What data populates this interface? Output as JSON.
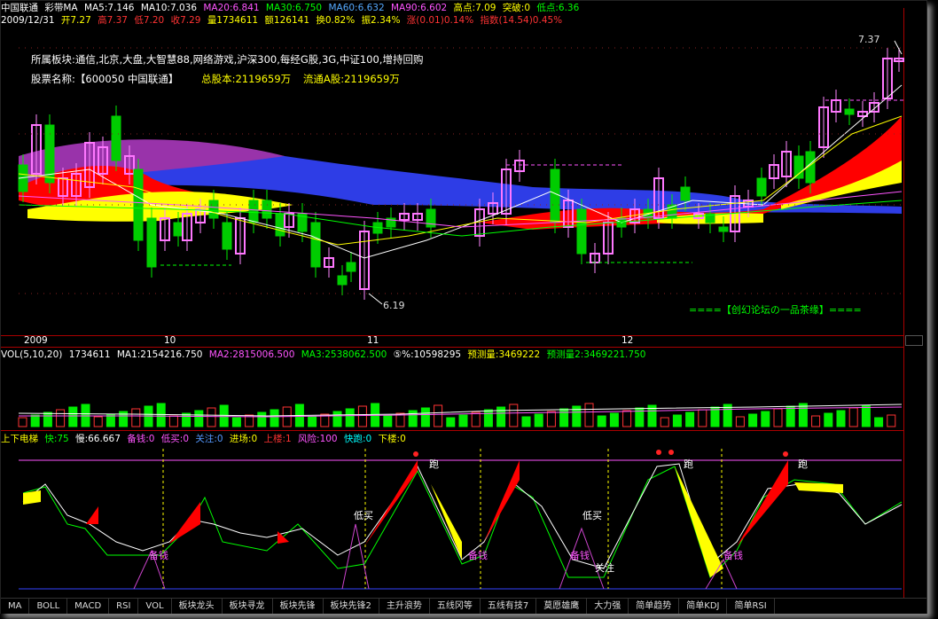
{
  "header": {
    "stock_name": "中国联通",
    "indicator": "彩带MA",
    "ma5": "MA5:7.146",
    "ma10": "MA10:7.036",
    "ma20": "MA20:6.841",
    "ma30": "MA30:6.750",
    "ma60": "MA60:6.632",
    "ma90": "MA90:6.602",
    "high_point": "高点:7.09",
    "breakout": "突破:0",
    "low_point": "低点:6.36"
  },
  "quote": {
    "date": "2009/12/31",
    "open": "开7.27",
    "high": "高7.37",
    "low": "低7.20",
    "close": "收7.29",
    "volume": "量1734611",
    "amount": "额126141",
    "turnover": "换0.82%",
    "amplitude": "振2.34%",
    "change": "涨(0.01)0.14%",
    "index": "指数(14.54)0.45%"
  },
  "info": {
    "sectors": "所属板块:通信,北京,大盘,大智慧88,网络游戏,沪深300,每经G股,3G,中证100,增持回购",
    "name_label": "股票名称:【600050 中国联通】",
    "total_shares": "总股本:2119659万",
    "float_shares": "流通A股:2119659万"
  },
  "price_chart": {
    "high_mark": "7.37",
    "low_mark": "6.19",
    "watermark": "====【创幻论坛の一品茶缘】===="
  },
  "time_axis": [
    "2009",
    "10",
    "11",
    "12"
  ],
  "volume_panel": {
    "title": "VOL(5,10,20)",
    "vol": "1734611",
    "ma1": "MA1:2154216.750",
    "ma2": "MA2:2815006.500",
    "ma3": "MA3:2538062.500",
    "pct": "⑤%:10598295",
    "forecast": "预测量:3469222",
    "forecast2": "预测量2:3469221.750"
  },
  "signal_panel": {
    "title": "上下电梯",
    "fast": "快:75",
    "slow": "慢:66.667",
    "reserve": "备钱:0",
    "buy_low": "低买:0",
    "watch": "关注:0",
    "enter": "进场:0",
    "up_floor": "上楼:1",
    "risk": "风险:100",
    "fast_run": "快跑:0",
    "down_floor": "下楼:0",
    "labels": {
      "run": "跑",
      "buy_low": "低买",
      "reserve": "备钱",
      "watch": "关注"
    }
  },
  "tabs": [
    "MA",
    "BOLL",
    "MACD",
    "RSI",
    "VOL",
    "板块龙头",
    "板块寻龙",
    "板块先锋",
    "板块先锋2",
    "主升浪势",
    "五线冈等",
    "五线有技7",
    "莫愿雄鹰",
    "大力强",
    "简单趋势",
    "简单KDJ",
    "简单RSI"
  ]
}
